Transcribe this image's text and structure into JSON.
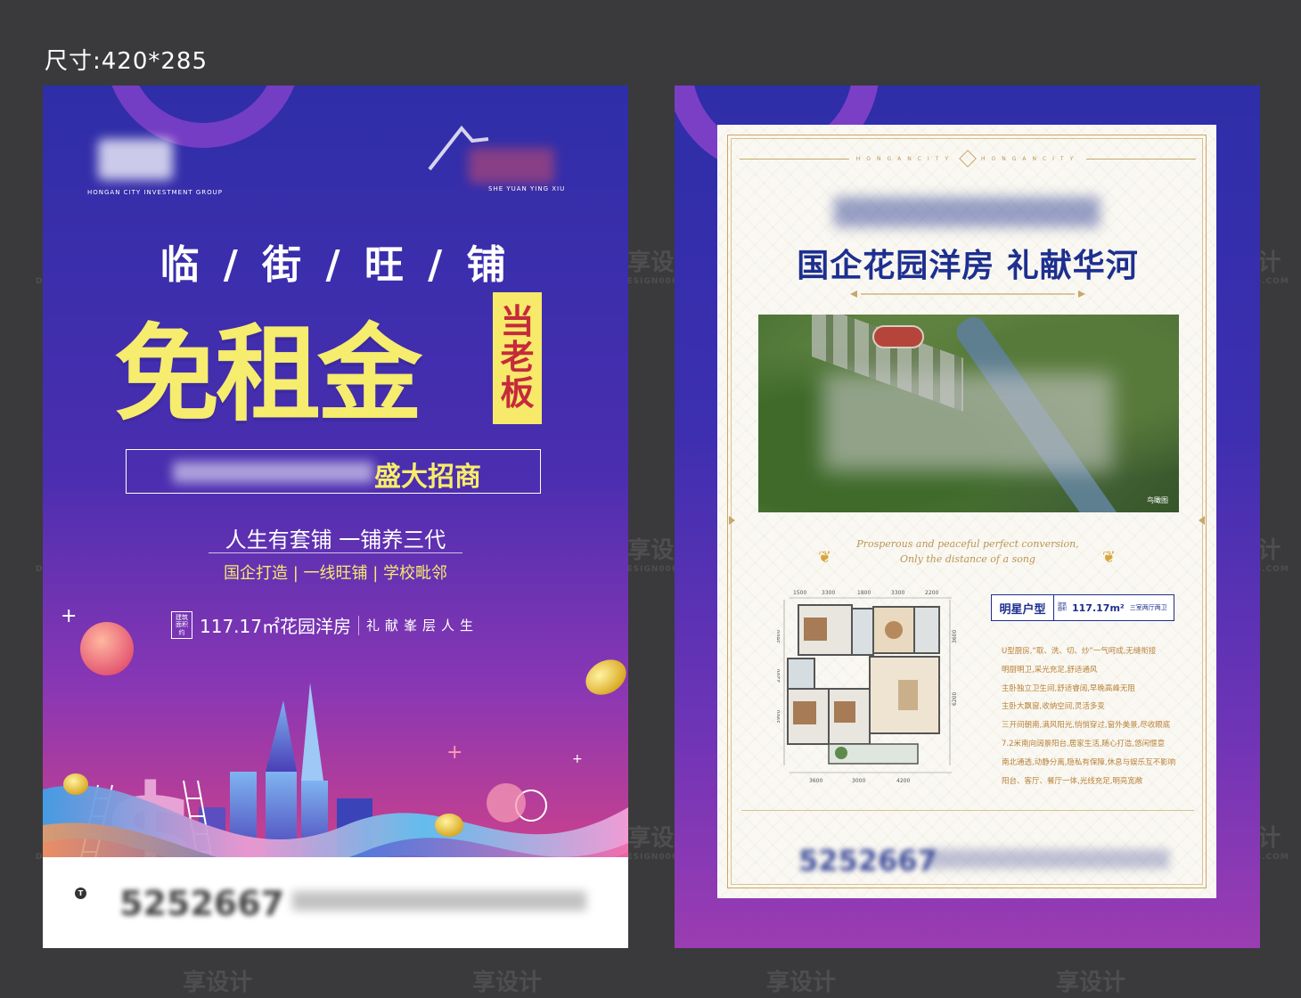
{
  "size_label": "尺寸:420*285",
  "watermark": {
    "cn": "享设计",
    "en": "DESIGN006.COM"
  },
  "left_poster": {
    "logo_left_sub": "HONGAN CITY INVESTMENT GROUP",
    "logo_right_sub": "SHE YUAN YING XIU",
    "headline": "临 / 街 / 旺 / 铺",
    "hero": "免租金",
    "hero_tag": [
      "当",
      "老",
      "板"
    ],
    "invite": "盛大招商",
    "slogan": "人生有套铺  一铺养三代",
    "features": "国企打造 | 一线旺铺 | 学校毗邻",
    "area_box": [
      "建筑",
      "面积约"
    ],
    "area": "117.17㎡花园洋房",
    "motto": "礼献峯层人生",
    "footer_icon": "T",
    "phone_blurred": "5252667"
  },
  "right_poster": {
    "border_text": "HONGANCITY",
    "title": "国企花园洋房  礼献华河",
    "aerial_caption": "鸟瞰图",
    "english_line1": "Prosperous and peaceful perfect conversion,",
    "english_line2": "Only the distance of a song",
    "unit_name": "明星户型",
    "unit_area_label": [
      "建筑",
      "面积"
    ],
    "unit_area": "117.17m²",
    "unit_rooms": "三室两厅两卫",
    "plan_dims_top": [
      "1500",
      "3300",
      "1800",
      "3300",
      "2200"
    ],
    "plan_dims_bottom": [
      "3600",
      "3000",
      "4200"
    ],
    "plan_dims_left": [
      "3600",
      "2200",
      "3900"
    ],
    "plan_dims_right": [
      "3600",
      "6200"
    ],
    "features": [
      "U型厨房,“取、洗、切、炒”一气呵成,无缝衔接",
      "明厨明卫,采光充足,舒适通风",
      "主卧独立卫生间,舒适睿阔,早晚高峰无阻",
      "主卧大飘窗,收纳空间,灵活多变",
      "三开间朝南,满风阳光,悄悄穿过,窗外美景,尽收眼底",
      "7.2米南向阔景阳台,居家生活,随心打造,悠闲惬意",
      "南北通透,动静分离,隐私有保障,休息与娱乐互不影响",
      "阳台、客厅、餐厅一体,光线充足,明亮宽敞"
    ],
    "phone_blurred": "5252667"
  },
  "colors": {
    "bg": "#3a3a3c",
    "poster_blue": "#2e2ea8",
    "hero_yellow": "#f6ec6e",
    "tag_red": "#c52a3b",
    "title_navy": "#1d2f8f",
    "gold": "#c7a867"
  }
}
